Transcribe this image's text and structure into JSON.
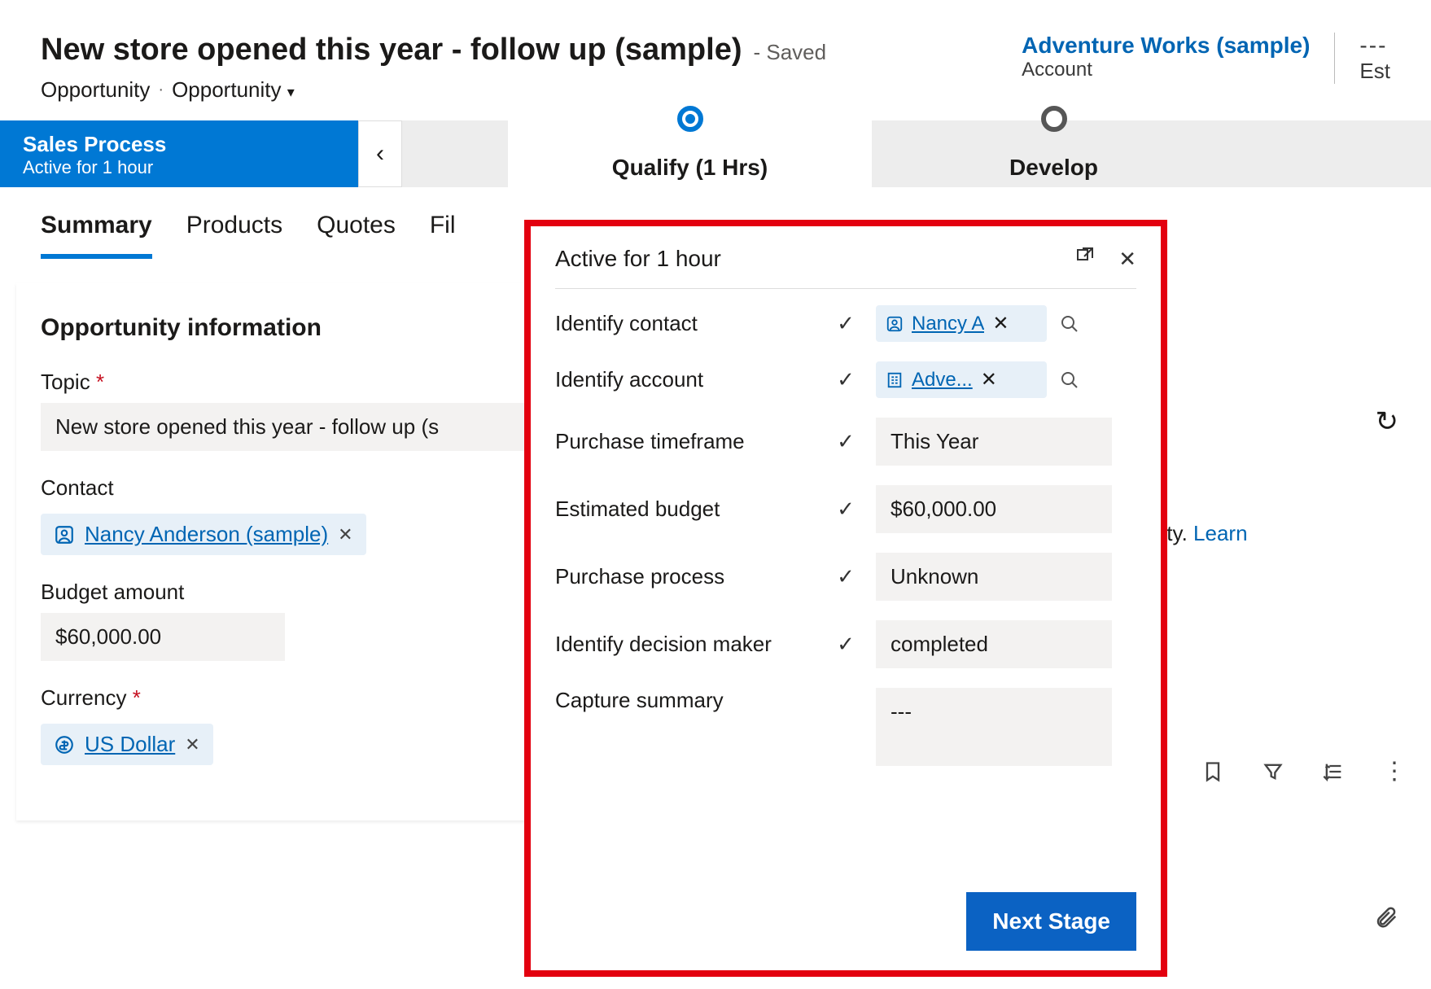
{
  "header": {
    "title": "New store opened this year - follow up (sample)",
    "saved_suffix": "- Saved",
    "entity": "Opportunity",
    "form": "Opportunity",
    "account_link": "Adventure Works (sample)",
    "account_label": "Account",
    "est_label": "Est",
    "est_value": "---"
  },
  "bpf": {
    "process_name": "Sales Process",
    "active_duration": "Active for 1 hour",
    "stages": [
      {
        "label": "Qualify  (1 Hrs)",
        "active": true
      },
      {
        "label": "Develop",
        "active": false
      }
    ]
  },
  "tabs": [
    {
      "label": "Summary",
      "active": true
    },
    {
      "label": "Products",
      "active": false
    },
    {
      "label": "Quotes",
      "active": false
    },
    {
      "label": "Fil",
      "active": false
    }
  ],
  "summary": {
    "section_title": "Opportunity information",
    "topic_label": "Topic",
    "topic_value": "New store opened this year - follow up (s",
    "contact_label": "Contact",
    "contact_value": "Nancy Anderson (sample)",
    "budget_label": "Budget amount",
    "budget_value": "$60,000.00",
    "currency_label": "Currency",
    "currency_value": "US Dollar"
  },
  "flyout": {
    "title": "Active for 1 hour",
    "fields": {
      "identify_contact": {
        "label": "Identify contact",
        "done": true,
        "value": "Nancy A"
      },
      "identify_account": {
        "label": "Identify account",
        "done": true,
        "value": "Adve..."
      },
      "purchase_timeframe": {
        "label": "Purchase timeframe",
        "done": true,
        "value": "This Year"
      },
      "estimated_budget": {
        "label": "Estimated budget",
        "done": true,
        "value": "$60,000.00"
      },
      "purchase_process": {
        "label": "Purchase process",
        "done": true,
        "value": "Unknown"
      },
      "identify_decision_maker": {
        "label": "Identify decision maker",
        "done": true,
        "value": "completed"
      },
      "capture_summary": {
        "label": "Capture summary",
        "done": false,
        "value": "---"
      }
    },
    "next_stage_label": "Next Stage"
  },
  "right": {
    "activity_hint_suffix": "an activity.",
    "learn_label": "Learn"
  }
}
